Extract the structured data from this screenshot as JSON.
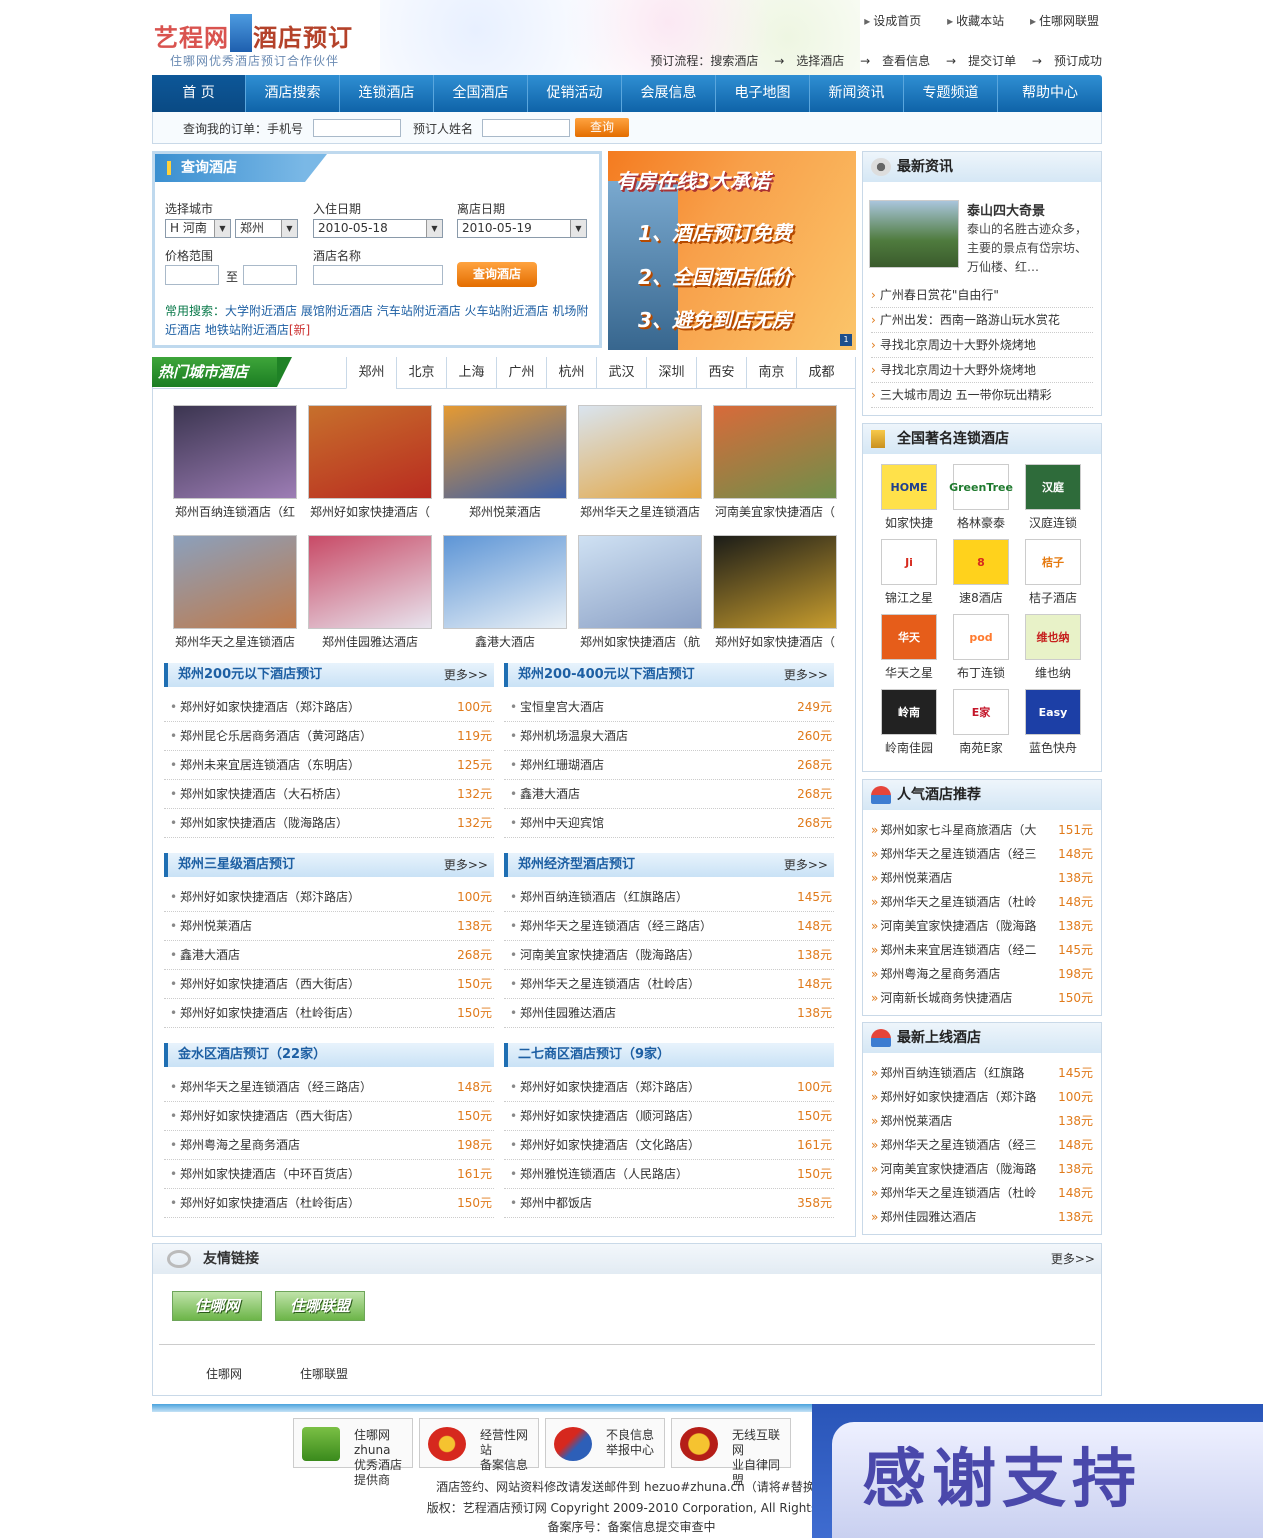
{
  "header": {
    "logo_part1": "艺程网",
    "logo_part2": "酒店预订",
    "logo_sub": "住哪网优秀酒店预订合作伙伴",
    "top_links": [
      "设成首页",
      "收藏本站",
      "住哪网联盟"
    ],
    "process_label": "预订流程：",
    "process_steps": [
      "搜索酒店",
      "选择酒店",
      "查看信息",
      "提交订单",
      "预订成功"
    ],
    "arrow": "→"
  },
  "nav": {
    "items": [
      "首 页",
      "酒店搜索",
      "连锁酒店",
      "全国酒店",
      "促销活动",
      "会展信息",
      "电子地图",
      "新闻资讯",
      "专题频道",
      "帮助中心"
    ],
    "active_index": 0
  },
  "order_query": {
    "label_phone": "查询我的订单：手机号",
    "label_name": "预订人姓名",
    "button": "查询"
  },
  "search": {
    "title": "查询酒店",
    "city_label": "选择城市",
    "province": "H 河南",
    "city": "郑州",
    "checkin_label": "入住日期",
    "checkin": "2010-05-18",
    "checkout_label": "离店日期",
    "checkout": "2010-05-19",
    "price_label": "价格范围",
    "price_to": "至",
    "name_label": "酒店名称",
    "button": "查询酒店",
    "common_label": "常用搜索：",
    "common_links": [
      "大学附近酒店",
      "展馆附近酒店",
      "汽车站附近酒店",
      "火车站附近酒店",
      "机场附近酒店",
      "地铁站附近酒店"
    ],
    "new_tag": "[新]"
  },
  "banner": {
    "title": "有房在线3大承诺",
    "items": [
      "1、酒店预订免费",
      "2、全国酒店低价",
      "3、避免到店无房"
    ],
    "page": "1"
  },
  "hot_cities": {
    "title": "热门城市酒店",
    "tabs": [
      "郑州",
      "北京",
      "上海",
      "广州",
      "杭州",
      "武汉",
      "深圳",
      "西安",
      "南京",
      "成都"
    ],
    "active_tab": 0,
    "photos": [
      {
        "caption": "郑州百纳连锁酒店（红",
        "c1": "#3b3550",
        "c2": "#9d7db5"
      },
      {
        "caption": "郑州好如家快捷酒店（",
        "c1": "#c7702c",
        "c2": "#b92b20"
      },
      {
        "caption": "郑州悦莱酒店",
        "c1": "#e59a32",
        "c2": "#3b5ea7"
      },
      {
        "caption": "郑州华天之星连锁酒店",
        "c1": "#d9e4ef",
        "c2": "#e3a540"
      },
      {
        "caption": "河南美宜家快捷酒店（",
        "c1": "#d86a3a",
        "c2": "#6f8f4a"
      },
      {
        "caption": "郑州华天之星连锁酒店",
        "c1": "#8ba0bc",
        "c2": "#c07a4a"
      },
      {
        "caption": "郑州佳园雅达酒店",
        "c1": "#c84a66",
        "c2": "#e8e4ee"
      },
      {
        "caption": "鑫港大酒店",
        "c1": "#5d95d6",
        "c2": "#e9f0f6"
      },
      {
        "caption": "郑州如家快捷酒店（航",
        "c1": "#cfe1f3",
        "c2": "#8a9fc4"
      },
      {
        "caption": "郑州好如家快捷酒店（",
        "c1": "#1b1c18",
        "c2": "#c89d2e"
      }
    ]
  },
  "lists": [
    {
      "title": "郑州200元以下酒店预订",
      "more": "更多>>",
      "rows": [
        {
          "name": "郑州好如家快捷酒店（郑汴路店）",
          "price": "100元"
        },
        {
          "name": "郑州昆仑乐居商务酒店（黄河路店）",
          "price": "119元"
        },
        {
          "name": "郑州未来宜居连锁酒店（东明店）",
          "price": "125元"
        },
        {
          "name": "郑州如家快捷酒店（大石桥店）",
          "price": "132元"
        },
        {
          "name": "郑州如家快捷酒店（陇海路店）",
          "price": "132元"
        }
      ]
    },
    {
      "title": "郑州200-400元以下酒店预订",
      "more": "更多>>",
      "rows": [
        {
          "name": "宝恒皇宫大酒店",
          "price": "249元"
        },
        {
          "name": "郑州机场温泉大酒店",
          "price": "260元"
        },
        {
          "name": "郑州红珊瑚酒店",
          "price": "268元"
        },
        {
          "name": "鑫港大酒店",
          "price": "268元"
        },
        {
          "name": "郑州中天迎宾馆",
          "price": "268元"
        }
      ]
    },
    {
      "title": "郑州三星级酒店预订",
      "more": "更多>>",
      "rows": [
        {
          "name": "郑州好如家快捷酒店（郑汴路店）",
          "price": "100元"
        },
        {
          "name": "郑州悦莱酒店",
          "price": "138元"
        },
        {
          "name": "鑫港大酒店",
          "price": "268元"
        },
        {
          "name": "郑州好如家快捷酒店（西大街店）",
          "price": "150元"
        },
        {
          "name": "郑州好如家快捷酒店（杜岭街店）",
          "price": "150元"
        }
      ]
    },
    {
      "title": "郑州经济型酒店预订",
      "more": "更多>>",
      "rows": [
        {
          "name": "郑州百纳连锁酒店（红旗路店）",
          "price": "145元"
        },
        {
          "name": "郑州华天之星连锁酒店（经三路店）",
          "price": "148元"
        },
        {
          "name": "河南美宜家快捷酒店（陇海路店）",
          "price": "138元"
        },
        {
          "name": "郑州华天之星连锁酒店（杜岭店）",
          "price": "148元"
        },
        {
          "name": "郑州佳园雅达酒店",
          "price": "138元"
        }
      ]
    },
    {
      "title": "金水区酒店预订（22家）",
      "more": "",
      "rows": [
        {
          "name": "郑州华天之星连锁酒店（经三路店）",
          "price": "148元"
        },
        {
          "name": "郑州好如家快捷酒店（西大街店）",
          "price": "150元"
        },
        {
          "name": "郑州粤海之星商务酒店",
          "price": "198元"
        },
        {
          "name": "郑州如家快捷酒店（中环百货店）",
          "price": "161元"
        },
        {
          "name": "郑州好如家快捷酒店（杜岭街店）",
          "price": "150元"
        }
      ]
    },
    {
      "title": "二七商区酒店预订（9家）",
      "more": "",
      "rows": [
        {
          "name": "郑州好如家快捷酒店（郑汴路店）",
          "price": "100元"
        },
        {
          "name": "郑州好如家快捷酒店（顺河路店）",
          "price": "150元"
        },
        {
          "name": "郑州好如家快捷酒店（文化路店）",
          "price": "161元"
        },
        {
          "name": "郑州雅悦连锁酒店（人民路店）",
          "price": "150元"
        },
        {
          "name": "郑州中都饭店",
          "price": "358元"
        }
      ]
    }
  ],
  "news": {
    "title": "最新资讯",
    "feature_title": "泰山四大奇景",
    "feature_text": "泰山的名胜古迹众多，主要的景点有岱宗坊、万仙楼、红…",
    "items": [
      "广州春日赏花\"自由行\"",
      "广州出发：西南一路游山玩水赏花",
      "寻找北京周边十大野外烧烤地",
      "寻找北京周边十大野外烧烤地",
      "三大城市周边 五一带你玩出精彩"
    ]
  },
  "chains": {
    "title": "全国著名连锁酒店",
    "brands": [
      {
        "name": "如家快捷",
        "mark": "HOME",
        "color": "#1e3f8f",
        "bg": "#ffe14a"
      },
      {
        "name": "格林豪泰",
        "mark": "GreenTree",
        "color": "#1f7a2e",
        "bg": "#ffffff"
      },
      {
        "name": "汉庭连锁",
        "mark": "汉庭",
        "color": "#ffffff",
        "bg": "#2e6b3a"
      },
      {
        "name": "锦江之星",
        "mark": "Ji",
        "color": "#d62a1e",
        "bg": "#ffffff"
      },
      {
        "name": "速8酒店",
        "mark": "8",
        "color": "#d62a1e",
        "bg": "#ffd21c"
      },
      {
        "name": "桔子酒店",
        "mark": "桔子",
        "color": "#e57a10",
        "bg": "#ffffff"
      },
      {
        "name": "华天之星",
        "mark": "华天",
        "color": "#ffffff",
        "bg": "#e65d1a"
      },
      {
        "name": "布丁连锁",
        "mark": "pod",
        "color": "#ff7a2e",
        "bg": "#ffffff"
      },
      {
        "name": "维也纳",
        "mark": "维也纳",
        "color": "#c6201e",
        "bg": "#e8f2c8"
      },
      {
        "name": "岭南佳园",
        "mark": "岭南",
        "color": "#ffffff",
        "bg": "#222222"
      },
      {
        "name": "南苑E家",
        "mark": "E家",
        "color": "#c4162a",
        "bg": "#ffffff"
      },
      {
        "name": "蓝色快舟",
        "mark": "Easy",
        "color": "#ffffff",
        "bg": "#1c3fa6"
      }
    ]
  },
  "popular": {
    "title": "人气酒店推荐",
    "items": [
      {
        "name": "郑州如家七斗星商旅酒店（大",
        "price": "151元"
      },
      {
        "name": "郑州华天之星连锁酒店（经三",
        "price": "148元"
      },
      {
        "name": "郑州悦莱酒店",
        "price": "138元"
      },
      {
        "name": "郑州华天之星连锁酒店（杜岭",
        "price": "148元"
      },
      {
        "name": "河南美宜家快捷酒店（陇海路",
        "price": "138元"
      },
      {
        "name": "郑州未来宜居连锁酒店（经二",
        "price": "145元"
      },
      {
        "name": "郑州粤海之星商务酒店",
        "price": "198元"
      },
      {
        "name": "河南新长城商务快捷酒店",
        "price": "150元"
      }
    ]
  },
  "latest": {
    "title": "最新上线酒店",
    "items": [
      {
        "name": "郑州百纳连锁酒店（红旗路",
        "price": "145元"
      },
      {
        "name": "郑州好如家快捷酒店（郑汴路",
        "price": "100元"
      },
      {
        "name": "郑州悦莱酒店",
        "price": "138元"
      },
      {
        "name": "郑州华天之星连锁酒店（经三",
        "price": "148元"
      },
      {
        "name": "河南美宜家快捷酒店（陇海路",
        "price": "138元"
      },
      {
        "name": "郑州华天之星连锁酒店（杜岭",
        "price": "148元"
      },
      {
        "name": "郑州佳园雅达酒店",
        "price": "138元"
      }
    ]
  },
  "friends": {
    "title": "友情链接",
    "more": "更多>>",
    "logo_links": [
      "住哪网",
      "住哪联盟"
    ],
    "text_links": [
      "住哪网",
      "住哪联盟"
    ]
  },
  "footer": {
    "badges": [
      {
        "line1": "住哪网 zhuna",
        "line2": "优秀酒店提供商"
      },
      {
        "line1": "经营性网站",
        "line2": "备案信息"
      },
      {
        "line1": "不良信息",
        "line2": "举报中心"
      },
      {
        "line1": "无线互联网",
        "line2": "业自律同盟"
      }
    ],
    "line1": "酒店签约、网站资料修改请发送邮件到 hezuo#zhuna.cn（请将#替换成",
    "line2": "版权：艺程酒店预订网 Copyright 2009-2010 Corporation, All Rights Re",
    "line3": "备案序号：备案信息提交审查中"
  },
  "overlay": {
    "text": "感谢支持"
  }
}
